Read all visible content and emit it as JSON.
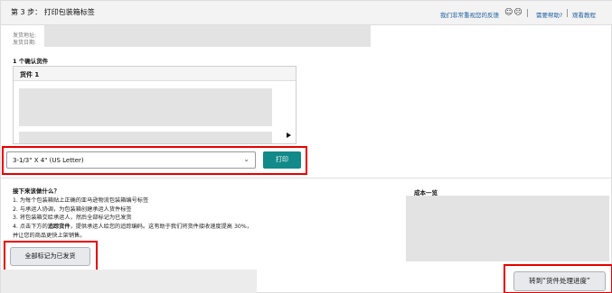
{
  "header": {
    "step_title": "第 3 步： 打印包装箱标签",
    "feedback_link": "我们非常重视您的反馈",
    "faces": "☺☹",
    "help_link": "需要帮助?",
    "tutorial_link": "观看教程"
  },
  "address": {
    "ship_from_label": "发货地址:",
    "ship_date_label": "发货日期:"
  },
  "confirm": {
    "title": "1 个确认货件",
    "shipment_label": "货件 1"
  },
  "label_select": {
    "value": "3-1/3\" X 4\" (US Letter)",
    "print_label": "打印"
  },
  "next_steps": {
    "title": "接下来该做什么？",
    "items": [
      "1. 为每个包装箱贴上正确的亚马逊物流包装箱编号标签",
      "2. 与承运人协调，为包装箱创建承运人货件标签",
      "3. 将包装箱交给承运人，然后全部标记为已发货"
    ],
    "item4_prefix": "4. 点击下方的",
    "item4_bold": "追踪货件",
    "item4_suffix": "，提供承运人给您的追踪编码。这有助于我们将货件接收速度提高 30%，",
    "item4_line2": "并让您的商品更快上架销售。"
  },
  "cost": {
    "title": "成本一览"
  },
  "actions": {
    "mark_shipped": "全部标记为已发货",
    "goto_progress": "转到“货件处理进度”"
  }
}
